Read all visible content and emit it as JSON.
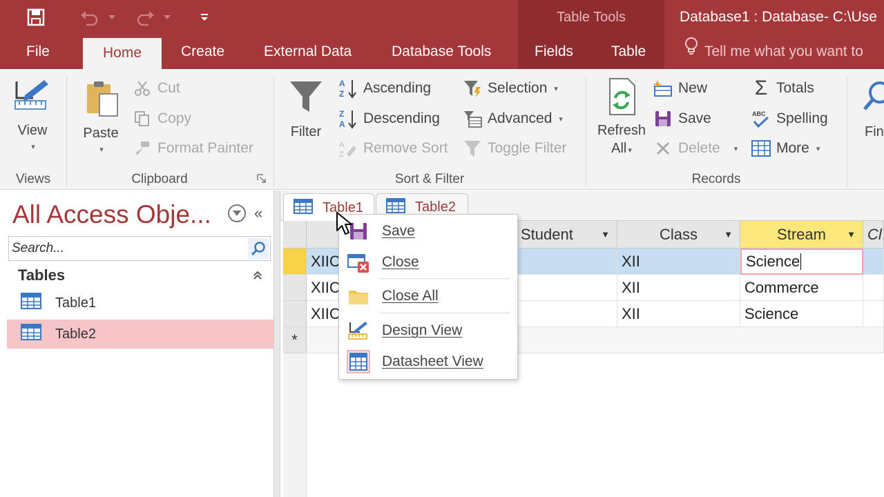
{
  "colors": {
    "accent": "#a4373a",
    "context_band": "#8e2c30",
    "selected_nav": "#f7c5c8",
    "highlight_header": "#fbe77a"
  },
  "titlebar": {
    "context_title": "Table Tools",
    "window_title": "Database1 : Database- C:\\Use"
  },
  "tabs": {
    "file": "File",
    "home": "Home",
    "create": "Create",
    "external_data": "External Data",
    "database_tools": "Database Tools",
    "fields": "Fields",
    "table": "Table"
  },
  "tellme": {
    "text": "Tell me what you want to"
  },
  "ribbon": {
    "views": {
      "view": "View",
      "group": "Views"
    },
    "clipboard": {
      "paste": "Paste",
      "cut": "Cut",
      "copy": "Copy",
      "format_painter": "Format Painter",
      "group": "Clipboard"
    },
    "sort_filter": {
      "filter": "Filter",
      "ascending": "Ascending",
      "descending": "Descending",
      "remove_sort": "Remove Sort",
      "selection": "Selection",
      "advanced": "Advanced",
      "toggle_filter": "Toggle Filter",
      "group": "Sort & Filter"
    },
    "records": {
      "refresh": "Refresh",
      "refresh_all": "All",
      "new": "New",
      "save": "Save",
      "delete": "Delete",
      "totals": "Totals",
      "spelling": "Spelling",
      "more": "More",
      "group": "Records"
    },
    "find": {
      "label": "Fin"
    }
  },
  "nav": {
    "title": "All Access Obje...",
    "search_placeholder": "Search...",
    "group": "Tables",
    "items": [
      {
        "label": "Table1"
      },
      {
        "label": "Table2"
      }
    ]
  },
  "doc_tabs": [
    {
      "label": "Table1"
    },
    {
      "label": "Table2"
    }
  ],
  "grid": {
    "columns": [
      "Student",
      "Class",
      "Stream",
      "Cl"
    ],
    "rows": [
      {
        "id": "XIIC",
        "class": "XII",
        "stream": "Science"
      },
      {
        "id": "XIIC",
        "class": "XII",
        "stream": "Commerce"
      },
      {
        "id": "XIIC",
        "class": "XII",
        "stream": "Science"
      }
    ],
    "new_row_marker": "*"
  },
  "context_menu": {
    "items": [
      {
        "label": "Save",
        "icon": "save-icon"
      },
      {
        "label": "Close",
        "icon": "close-table-icon"
      },
      {
        "label": "Close All",
        "icon": "folder-icon"
      },
      {
        "label": "Design View",
        "icon": "design-view-icon"
      },
      {
        "label": "Datasheet View",
        "icon": "datasheet-view-icon"
      }
    ]
  }
}
